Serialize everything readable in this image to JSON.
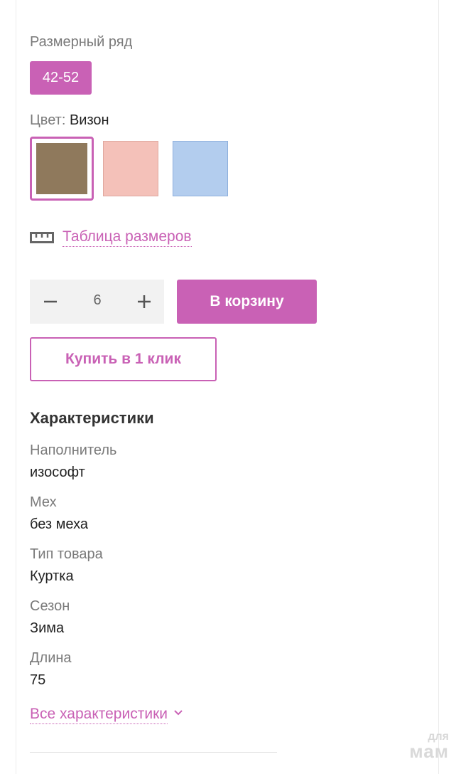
{
  "size_section": {
    "label": "Размерный ряд",
    "selected_size": "42-52"
  },
  "color_section": {
    "label": "Цвет:",
    "selected_color": "Визон",
    "swatches": [
      {
        "name": "Визон",
        "hex": "#8f795c",
        "selected": true
      },
      {
        "name": "pink",
        "hex": "#f4c1b9",
        "selected": false
      },
      {
        "name": "blue",
        "hex": "#b3cdee",
        "selected": false
      }
    ]
  },
  "size_table": {
    "icon": "ruler-icon",
    "link_text": "Таблица размеров"
  },
  "purchase": {
    "quantity": "6",
    "add_to_cart_label": "В корзину",
    "one_click_label": "Купить в 1 клик"
  },
  "specs": {
    "title": "Характеристики",
    "items": [
      {
        "label": "Наполнитель",
        "value": "изософт"
      },
      {
        "label": "Мех",
        "value": "без меха"
      },
      {
        "label": "Тип товара",
        "value": "Куртка"
      },
      {
        "label": "Сезон",
        "value": "Зима"
      },
      {
        "label": "Длина",
        "value": "75"
      }
    ],
    "all_link": "Все характеристики"
  },
  "watermark": {
    "top": "для",
    "bottom": "мам"
  },
  "colors": {
    "accent": "#c961b5",
    "stepper_bg": "#f2f2f2"
  }
}
